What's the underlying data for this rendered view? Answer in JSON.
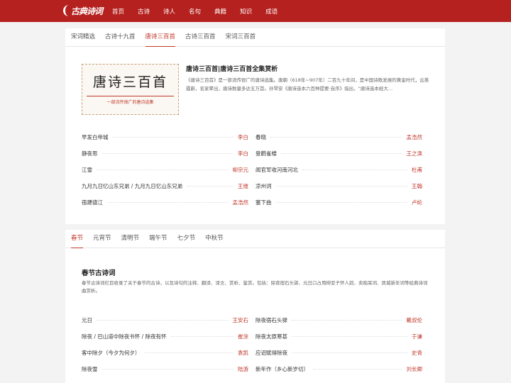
{
  "logo": "古典诗词",
  "nav": [
    "首页",
    "古诗",
    "诗人",
    "名句",
    "典籍",
    "知识",
    "成语"
  ],
  "collection": {
    "tabs": [
      "宋词精选",
      "古诗十九首",
      "唐诗三百首",
      "古诗三百首",
      "宋词三百首"
    ],
    "active_tab": 2,
    "cover_title": "唐诗三百首",
    "cover_slogan": "一部流传很广的唐诗选集",
    "title": "唐诗三百首|唐诗三百首全集赏析",
    "description": "《唐诗三百首》是一部流传很广的唐诗选集。唐朝（618年~907年）二百九十年间，是中国诗歌发展的黄金时代，云蒸霞蔚，名家辈出，唐诗数量多达五万首。孙琴安《唐诗选本六百种提要·自序》指出，“唐诗选本经大...",
    "poems": [
      {
        "title": "早发白帝城",
        "author": "李白"
      },
      {
        "title": "春晓",
        "author": "孟浩然"
      },
      {
        "title": "静夜思",
        "author": "李白"
      },
      {
        "title": "登鹳雀楼",
        "author": "王之涣"
      },
      {
        "title": "江雪",
        "author": "柳宗元"
      },
      {
        "title": "闻官军收河南河北",
        "author": "杜甫"
      },
      {
        "title": "九月九日忆山东兄弟 / 九月九日忆山东兄弟",
        "author": "王维"
      },
      {
        "title": "凉州词",
        "author": "王翰"
      },
      {
        "title": "宿建德江",
        "author": "孟浩然"
      },
      {
        "title": "塞下曲",
        "author": "卢纶"
      }
    ]
  },
  "festival": {
    "tabs": [
      "春节",
      "元宵节",
      "清明节",
      "端午节",
      "七夕节",
      "中秋节"
    ],
    "active_tab": 0,
    "title": "春节古诗词",
    "description": "春节古诗词栏目收录了关于春节的古诗，以及诗句的注释、翻译、译文、赏析、鉴赏。包括：除夜宿石头驿、元日口占用柳亚子怀人韵、卖痴呆词、凤城新年词等经典诗词曲赏析。",
    "poems": [
      {
        "title": "元日",
        "author": "王安石"
      },
      {
        "title": "除夜宿石头驿",
        "author": "戴叔伦"
      },
      {
        "title": "除夜 / 巴山道中除夜书怀 / 除夜有怀",
        "author": "崔涂"
      },
      {
        "title": "除夜太原寒甚",
        "author": "于谦"
      },
      {
        "title": "客中除夕（今夕为何夕）",
        "author": "袁凯"
      },
      {
        "title": "应诏赋得除夜",
        "author": "史青"
      },
      {
        "title": "除夜雪",
        "author": "陆游"
      },
      {
        "title": "新年作（乡心新岁切）",
        "author": "刘长卿"
      }
    ]
  }
}
